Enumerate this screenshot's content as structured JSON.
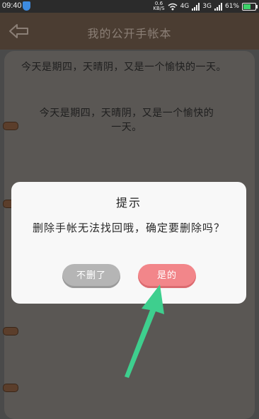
{
  "status_bar": {
    "time": "09:40",
    "net_speed_value": "0.6",
    "net_speed_unit": "KB/S",
    "network_1": "4G",
    "network_2": "3G",
    "battery": "61%",
    "icons": [
      "shield-icon",
      "wifi-icon",
      "signal-icon",
      "battery-icon"
    ]
  },
  "header": {
    "title": "我的公开手帐本",
    "back_icon": "back-arrow-icon"
  },
  "notebook": {
    "entries": [
      {
        "text": "今天是期四，天晴阴，又是一个愉快的一天。"
      },
      {
        "line1": "今天是期四，天晴阴，又是一个愉快的",
        "line2": "一天。"
      }
    ]
  },
  "dialog": {
    "title": "提示",
    "message": "删除手帐无法找回哦，确定要删除吗？",
    "cancel_label": "不删了",
    "confirm_label": "是的"
  },
  "colors": {
    "overlay_background": "#4a4a4a",
    "header": "#4b3d32",
    "cancel_button": "#b5b5b5",
    "confirm_button": "#f2868a",
    "annotation_arrow": "#3ecf8e"
  }
}
